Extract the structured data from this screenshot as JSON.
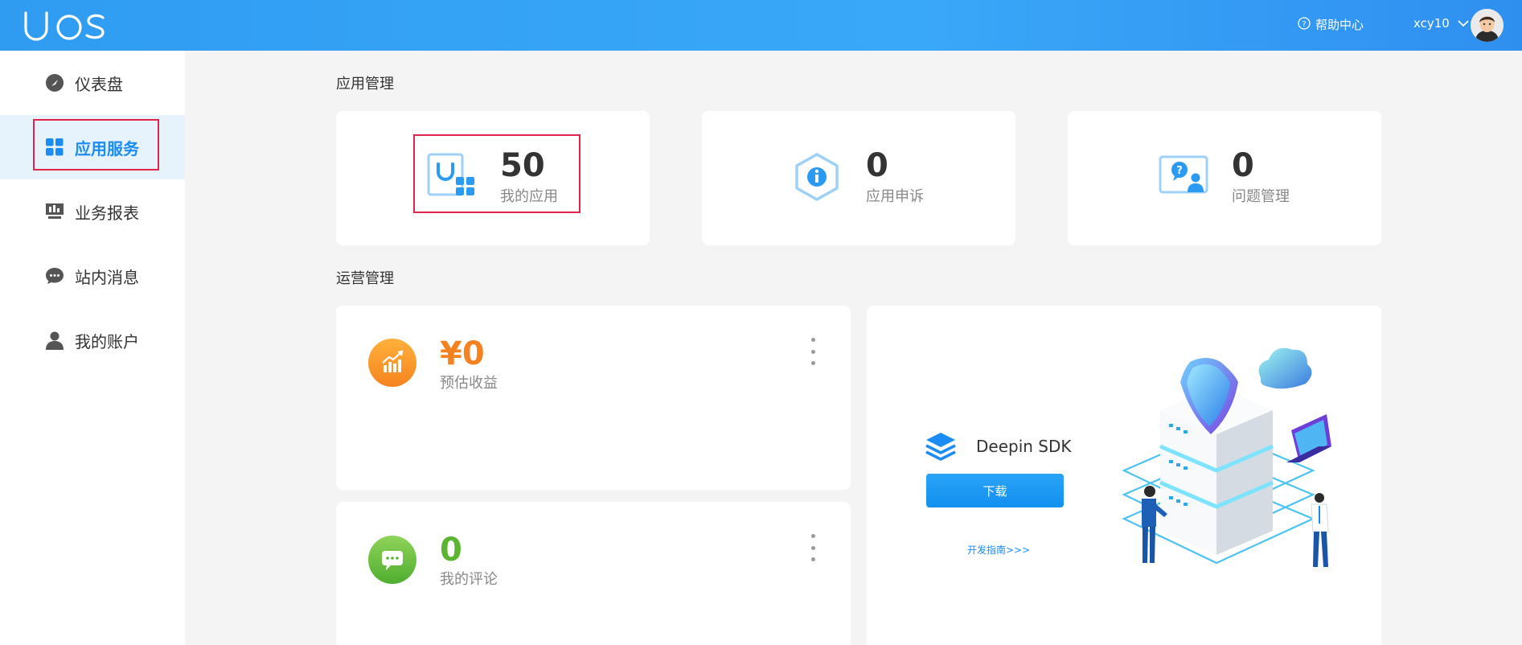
{
  "header": {
    "logo_text": "UOS",
    "help_label": "帮助中心",
    "username": "xcy10"
  },
  "sidebar": {
    "items": [
      {
        "label": "仪表盘",
        "icon": "dashboard-icon"
      },
      {
        "label": "应用服务",
        "icon": "grid-icon",
        "active": true
      },
      {
        "label": "业务报表",
        "icon": "report-icon"
      },
      {
        "label": "站内消息",
        "icon": "message-icon"
      },
      {
        "label": "我的账户",
        "icon": "user-icon"
      }
    ]
  },
  "app_management": {
    "title": "应用管理",
    "cards": [
      {
        "value": "50",
        "label": "我的应用",
        "icon": "my-apps-icon"
      },
      {
        "value": "0",
        "label": "应用申诉",
        "icon": "info-hexagon-icon"
      },
      {
        "value": "0",
        "label": "问题管理",
        "icon": "question-user-icon"
      }
    ]
  },
  "operations": {
    "title": "运营管理",
    "revenue": {
      "value": "¥0",
      "label": "预估收益",
      "color": "#f58220"
    },
    "comments": {
      "value": "0",
      "label": "我的评论",
      "color": "#5cb531"
    },
    "sdk": {
      "name": "Deepin SDK",
      "download_label": "下载",
      "guide_label": "开发指南>>>"
    }
  },
  "colors": {
    "accent": "#1a8cf3",
    "highlight": "#e0244c"
  }
}
